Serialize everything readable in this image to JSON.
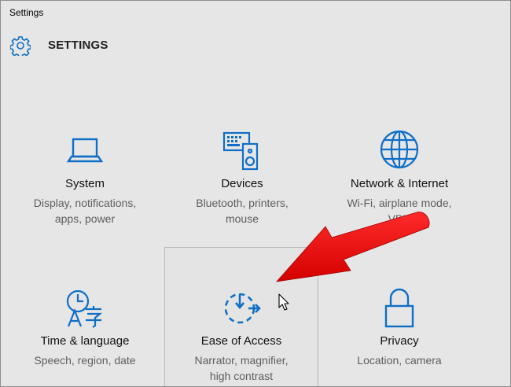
{
  "window": {
    "title": "Settings"
  },
  "header": {
    "title": "SETTINGS",
    "icon": "gear-icon"
  },
  "colors": {
    "accent": "#0f6fc6",
    "arrow": "#e00000"
  },
  "tiles": [
    {
      "name": "System",
      "desc1": "Display, notifications,",
      "desc2": "apps, power",
      "icon": "laptop-icon"
    },
    {
      "name": "Devices",
      "desc1": "Bluetooth, printers,",
      "desc2": "mouse",
      "icon": "keyboard-speaker-icon"
    },
    {
      "name": "Network & Internet",
      "desc1": "Wi-Fi, airplane mode,",
      "desc2": "VPN",
      "icon": "globe-icon"
    },
    {
      "name": "Time & language",
      "desc1": "Speech, region, date",
      "desc2": "",
      "icon": "clock-language-icon"
    },
    {
      "name": "Ease of Access",
      "desc1": "Narrator, magnifier,",
      "desc2": "high contrast",
      "icon": "ease-of-access-icon"
    },
    {
      "name": "Privacy",
      "desc1": "Location, camera",
      "desc2": "",
      "icon": "lock-icon"
    }
  ]
}
